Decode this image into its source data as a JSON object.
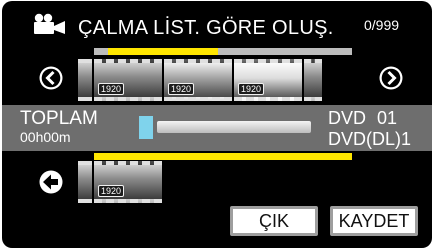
{
  "header": {
    "icon": "movie-camera-icon",
    "title": "ÇALMA LİST. GÖRE OLUŞ.",
    "counter": "0/999"
  },
  "playlist_bar": {
    "position_fraction": 0.45
  },
  "thumbnails_top": [
    {
      "badge": "1920"
    },
    {
      "badge": "1920"
    },
    {
      "badge": "1920"
    }
  ],
  "thumbnails_bottom": [
    {
      "badge": "1920"
    }
  ],
  "info": {
    "total_label": "TOPLAM",
    "total_time": "00h00m",
    "disc_type": "DVD",
    "disc_count": "01",
    "disc_dl_label": "DVD(DL)1"
  },
  "buttons": {
    "exit_label": "ÇIK",
    "save_label": "KAYDET"
  },
  "icons": {
    "prev": "chevron-left-icon",
    "next": "chevron-right-icon",
    "back": "arrow-left-icon"
  },
  "colors": {
    "accent_yellow": "#ffe600",
    "capacity_fill": "#7fd3ec",
    "info_band": "#6e6e6e"
  }
}
